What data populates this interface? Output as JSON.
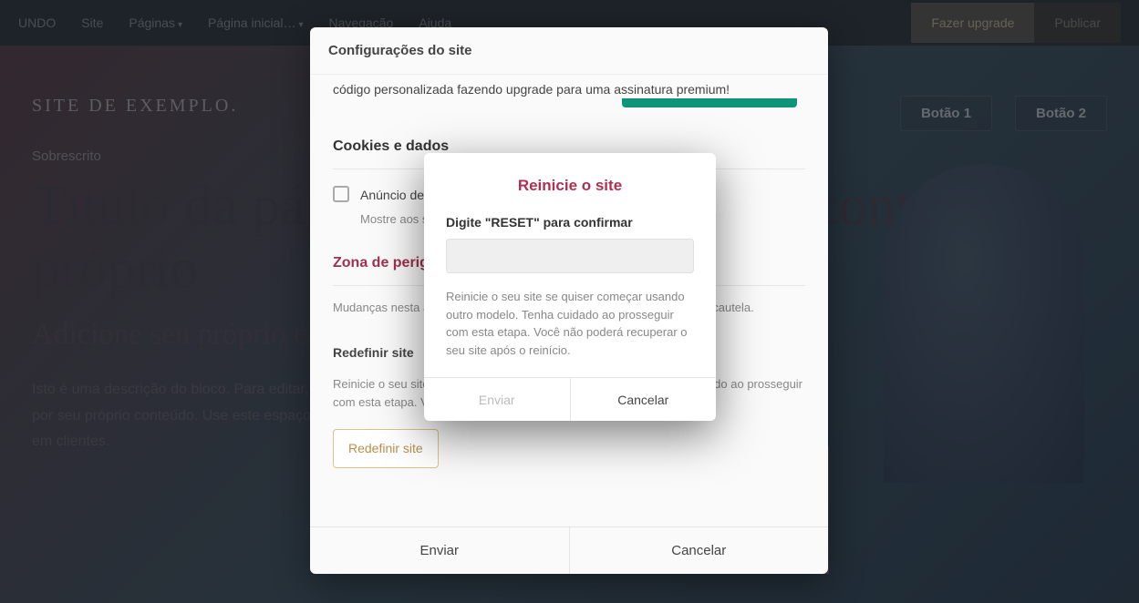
{
  "topbar": {
    "undo": "UNDO",
    "site": "Site",
    "pages": "Páginas",
    "page_start": "Página inicial…",
    "navigation": "Navegação",
    "help": "Ajuda",
    "upgrade": "Fazer upgrade",
    "publish": "Publicar"
  },
  "page": {
    "site_name": "SITE DE EXEMPLO.",
    "btn1": "Botão 1",
    "btn2": "Botão 2",
    "overline": "Sobrescrito",
    "headline": "Título da página. Substitua-o com conteúdo próprio",
    "subtitle": "Adicione seu próprio conteúdo aqui",
    "desc": "Isto é uma descrição do bloco. Para editar, clique e digite o texto e substitua-o por seu próprio conteúdo. Use este espaço para converter visitantes do site em clientes."
  },
  "settings": {
    "title": "Configurações do site",
    "promo": "código personalizada fazendo upgrade para uma assinatura premium!",
    "cookies_section": "Cookies e dados",
    "cookie_checkbox": "Anúncio de cookie",
    "cookie_desc": "Mostre aos seus visitantes que está usando cookies em seu site",
    "danger_title": "Zona de perigo",
    "danger_text": "Mudanças nesta área podem afetar todo o site. Por favor, prossiga com cautela.",
    "reset_title": "Redefinir site",
    "reset_text": "Reinicie o seu site se quiser começar usando outro modelo. Tenha cuidado ao prosseguir com esta etapa. Você não poderá recuperar o seu site após o reinício.",
    "reset_btn": "Redefinir site",
    "send": "Enviar",
    "cancel": "Cancelar"
  },
  "confirm": {
    "title": "Reinicie o site",
    "label": "Digite \"RESET\" para confirmar",
    "input_value": "",
    "desc": "Reinicie o seu site se quiser começar usando outro modelo. Tenha cuidado ao prosseguir com esta etapa. Você não poderá recuperar o seu site após o reinício.",
    "send": "Enviar",
    "cancel": "Cancelar"
  }
}
